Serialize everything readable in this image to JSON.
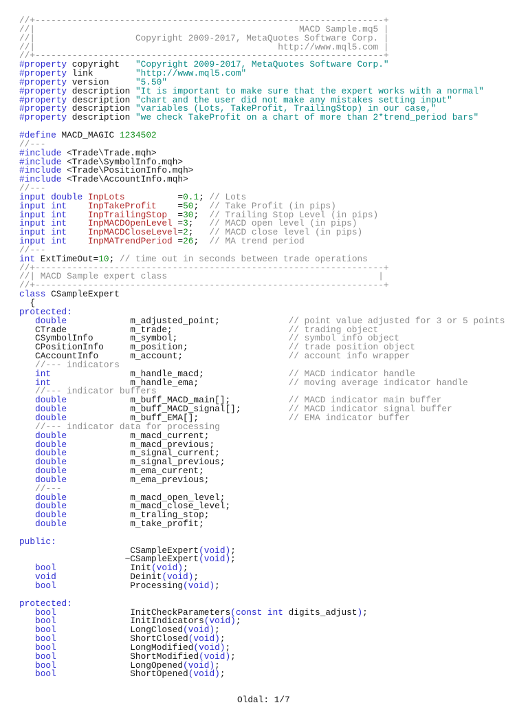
{
  "code": {
    "lines": [
      [
        [
          "c",
          "//+------------------------------------------------------------------+"
        ]
      ],
      [
        [
          "c",
          "//|"
        ],
        [
          "c r",
          "MACD Sample.mq5 |"
        ]
      ],
      [
        [
          "c",
          "//|"
        ],
        [
          "c r",
          "Copyright 2009-2017, MetaQuotes Software Corp. |"
        ]
      ],
      [
        [
          "c",
          "//|"
        ],
        [
          "c r",
          "http://www.mql5.com |"
        ]
      ],
      [
        [
          "c",
          "//+------------------------------------------------------------------+"
        ]
      ],
      [
        [
          "k",
          "#property"
        ],
        [
          "p",
          " copyright   "
        ],
        [
          "s",
          "\"Copyright 2009-2017, MetaQuotes Software Corp.\""
        ]
      ],
      [
        [
          "k",
          "#property"
        ],
        [
          "p",
          " link        "
        ],
        [
          "s",
          "\"http://www.mql5.com\""
        ]
      ],
      [
        [
          "k",
          "#property"
        ],
        [
          "p",
          " version     "
        ],
        [
          "s",
          "\"5.50\""
        ]
      ],
      [
        [
          "k",
          "#property"
        ],
        [
          "p",
          " description "
        ],
        [
          "s",
          "\"It is important to make sure that the expert works with a normal\""
        ]
      ],
      [
        [
          "k",
          "#property"
        ],
        [
          "p",
          " description "
        ],
        [
          "s",
          "\"chart and the user did not make any mistakes setting input\""
        ]
      ],
      [
        [
          "k",
          "#property"
        ],
        [
          "p",
          " description "
        ],
        [
          "s",
          "\"variables (Lots, TakeProfit, TrailingStop) in our case,\""
        ]
      ],
      [
        [
          "k",
          "#property"
        ],
        [
          "p",
          " description "
        ],
        [
          "s",
          "\"we check TakeProfit on a chart of more than 2*trend_period bars\""
        ]
      ],
      [],
      [
        [
          "k",
          "#define"
        ],
        [
          "p",
          " MACD_MAGIC "
        ],
        [
          "n",
          "1234502"
        ]
      ],
      [
        [
          "c",
          "//---"
        ]
      ],
      [
        [
          "k",
          "#include"
        ],
        [
          "p",
          " <Trade\\Trade.mqh>"
        ]
      ],
      [
        [
          "k",
          "#include"
        ],
        [
          "p",
          " <Trade\\SymbolInfo.mqh>"
        ]
      ],
      [
        [
          "k",
          "#include"
        ],
        [
          "p",
          " <Trade\\PositionInfo.mqh>"
        ]
      ],
      [
        [
          "k",
          "#include"
        ],
        [
          "p",
          " <Trade\\AccountInfo.mqh>"
        ]
      ],
      [
        [
          "c",
          "//---"
        ]
      ],
      [
        [
          "k",
          "input double "
        ],
        [
          "i icol",
          "InpLots"
        ],
        [
          "p",
          "="
        ],
        [
          "n",
          "0.1"
        ],
        [
          "p",
          "; "
        ],
        [
          "c",
          "// Lots"
        ]
      ],
      [
        [
          "k",
          "input int    "
        ],
        [
          "i icol",
          "InpTakeProfit"
        ],
        [
          "p",
          "="
        ],
        [
          "n",
          "50"
        ],
        [
          "p",
          ";  "
        ],
        [
          "c",
          "// Take Profit (in pips)"
        ]
      ],
      [
        [
          "k",
          "input int    "
        ],
        [
          "i icol",
          "InpTrailingStop"
        ],
        [
          "p",
          "="
        ],
        [
          "n",
          "30"
        ],
        [
          "p",
          ";  "
        ],
        [
          "c",
          "// Trailing Stop Level (in pips)"
        ]
      ],
      [
        [
          "k",
          "input int    "
        ],
        [
          "i icol",
          "InpMACDOpenLevel"
        ],
        [
          "p",
          "="
        ],
        [
          "n",
          "3"
        ],
        [
          "p",
          ";   "
        ],
        [
          "c",
          "// MACD open level (in pips)"
        ]
      ],
      [
        [
          "k",
          "input int    "
        ],
        [
          "i icol",
          "InpMACDCloseLevel"
        ],
        [
          "p",
          "="
        ],
        [
          "n",
          "2"
        ],
        [
          "p",
          ";   "
        ],
        [
          "c",
          "// MACD close level (in pips)"
        ]
      ],
      [
        [
          "k",
          "input int    "
        ],
        [
          "i icol",
          "InpMATrendPeriod"
        ],
        [
          "p",
          "="
        ],
        [
          "n",
          "26"
        ],
        [
          "p",
          ";  "
        ],
        [
          "c",
          "// MA trend period"
        ]
      ],
      [
        [
          "c",
          "//---"
        ]
      ],
      [
        [
          "k",
          "int"
        ],
        [
          "p",
          " ExtTimeOut="
        ],
        [
          "n",
          "10"
        ],
        [
          "p",
          "; "
        ],
        [
          "c",
          "// time out in seconds between trade operations"
        ]
      ],
      [
        [
          "c",
          "//+------------------------------------------------------------------+"
        ]
      ],
      [
        [
          "c",
          "//| MACD Sample expert class"
        ],
        [
          "c r2",
          "|"
        ]
      ],
      [
        [
          "c",
          "//+------------------------------------------------------------------+"
        ]
      ],
      [
        [
          "k",
          "class"
        ],
        [
          "p",
          " CSampleExpert"
        ]
      ],
      [
        [
          "p",
          "  {"
        ]
      ],
      [
        [
          "k",
          "protected:"
        ]
      ],
      [
        [
          "k tcol",
          "double"
        ],
        [
          "p ncol",
          "m_adjusted_point;"
        ],
        [
          "c",
          "// point value adjusted for 3 or 5 points"
        ]
      ],
      [
        [
          "p tcol",
          "CTrade"
        ],
        [
          "p ncol",
          "m_trade;"
        ],
        [
          "c",
          "// trading object"
        ]
      ],
      [
        [
          "p tcol",
          "CSymbolInfo"
        ],
        [
          "p ncol",
          "m_symbol;"
        ],
        [
          "c",
          "// symbol info object"
        ]
      ],
      [
        [
          "p tcol",
          "CPositionInfo"
        ],
        [
          "p ncol",
          "m_position;"
        ],
        [
          "c",
          "// trade position object"
        ]
      ],
      [
        [
          "p tcol",
          "CAccountInfo"
        ],
        [
          "p ncol",
          "m_account;"
        ],
        [
          "c",
          "// account info wrapper"
        ]
      ],
      [
        [
          "c",
          "   //--- indicators"
        ]
      ],
      [
        [
          "k tcol",
          "int"
        ],
        [
          "p ncol",
          "m_handle_macd;"
        ],
        [
          "c",
          "// MACD indicator handle"
        ]
      ],
      [
        [
          "k tcol",
          "int"
        ],
        [
          "p ncol",
          "m_handle_ema;"
        ],
        [
          "c",
          "// moving average indicator handle"
        ]
      ],
      [
        [
          "c",
          "   //--- indicator buffers"
        ]
      ],
      [
        [
          "k tcol",
          "double"
        ],
        [
          "p ncol",
          "m_buff_MACD_main[];"
        ],
        [
          "c",
          "// MACD indicator main buffer"
        ]
      ],
      [
        [
          "k tcol",
          "double"
        ],
        [
          "p ncol",
          "m_buff_MACD_signal[];"
        ],
        [
          "c",
          "// MACD indicator signal buffer"
        ]
      ],
      [
        [
          "k tcol",
          "double"
        ],
        [
          "p ncol",
          "m_buff_EMA[];"
        ],
        [
          "c",
          "// EMA indicator buffer"
        ]
      ],
      [
        [
          "c",
          "   //--- indicator data for processing"
        ]
      ],
      [
        [
          "k tcol",
          "double"
        ],
        [
          "p",
          "m_macd_current;"
        ]
      ],
      [
        [
          "k tcol",
          "double"
        ],
        [
          "p",
          "m_macd_previous;"
        ]
      ],
      [
        [
          "k tcol",
          "double"
        ],
        [
          "p",
          "m_signal_current;"
        ]
      ],
      [
        [
          "k tcol",
          "double"
        ],
        [
          "p",
          "m_signal_previous;"
        ]
      ],
      [
        [
          "k tcol",
          "double"
        ],
        [
          "p",
          "m_ema_current;"
        ]
      ],
      [
        [
          "k tcol",
          "double"
        ],
        [
          "p",
          "m_ema_previous;"
        ]
      ],
      [
        [
          "c",
          "   //---"
        ]
      ],
      [
        [
          "k tcol",
          "double"
        ],
        [
          "p",
          "m_macd_open_level;"
        ]
      ],
      [
        [
          "k tcol",
          "double"
        ],
        [
          "p",
          "m_macd_close_level;"
        ]
      ],
      [
        [
          "k tcol",
          "double"
        ],
        [
          "p",
          "m_traling_stop;"
        ]
      ],
      [
        [
          "k tcol",
          "double"
        ],
        [
          "p",
          "m_take_profit;"
        ]
      ],
      [],
      [
        [
          "k",
          "public:"
        ]
      ],
      [
        [
          "p pad21",
          "CSampleExpert"
        ],
        [
          "k",
          "(void)"
        ],
        [
          "p",
          ";"
        ]
      ],
      [
        [
          "p pad20",
          "~CSampleExpert"
        ],
        [
          "k",
          "(void)"
        ],
        [
          "p",
          ";"
        ]
      ],
      [
        [
          "k tcol",
          "bool"
        ],
        [
          "p",
          "Init"
        ],
        [
          "k",
          "(void)"
        ],
        [
          "p",
          ";"
        ]
      ],
      [
        [
          "k tcol",
          "void"
        ],
        [
          "p",
          "Deinit"
        ],
        [
          "k",
          "(void)"
        ],
        [
          "p",
          ";"
        ]
      ],
      [
        [
          "k tcol",
          "bool"
        ],
        [
          "p",
          "Processing"
        ],
        [
          "k",
          "(void)"
        ],
        [
          "p",
          ";"
        ]
      ],
      [],
      [
        [
          "k",
          "protected:"
        ]
      ],
      [
        [
          "k tcol",
          "bool"
        ],
        [
          "p",
          "InitCheckParameters"
        ],
        [
          "k",
          "(const int"
        ],
        [
          "p",
          " digits_adjust"
        ],
        [
          "k",
          ")"
        ],
        [
          "p",
          ";"
        ]
      ],
      [
        [
          "k tcol",
          "bool"
        ],
        [
          "p",
          "InitIndicators"
        ],
        [
          "k",
          "(void)"
        ],
        [
          "p",
          ";"
        ]
      ],
      [
        [
          "k tcol",
          "bool"
        ],
        [
          "p",
          "LongClosed"
        ],
        [
          "k",
          "(void)"
        ],
        [
          "p",
          ";"
        ]
      ],
      [
        [
          "k tcol",
          "bool"
        ],
        [
          "p",
          "ShortClosed"
        ],
        [
          "k",
          "(void)"
        ],
        [
          "p",
          ";"
        ]
      ],
      [
        [
          "k tcol",
          "bool"
        ],
        [
          "p",
          "LongModified"
        ],
        [
          "k",
          "(void)"
        ],
        [
          "p",
          ";"
        ]
      ],
      [
        [
          "k tcol",
          "bool"
        ],
        [
          "p",
          "ShortModified"
        ],
        [
          "k",
          "(void)"
        ],
        [
          "p",
          ";"
        ]
      ],
      [
        [
          "k tcol",
          "bool"
        ],
        [
          "p",
          "LongOpened"
        ],
        [
          "k",
          "(void)"
        ],
        [
          "p",
          ";"
        ]
      ],
      [
        [
          "k tcol",
          "bool"
        ],
        [
          "p",
          "ShortOpened"
        ],
        [
          "k",
          "(void)"
        ],
        [
          "p",
          ";"
        ]
      ]
    ]
  },
  "footer": {
    "page_label": "Oldal: 1/7"
  }
}
